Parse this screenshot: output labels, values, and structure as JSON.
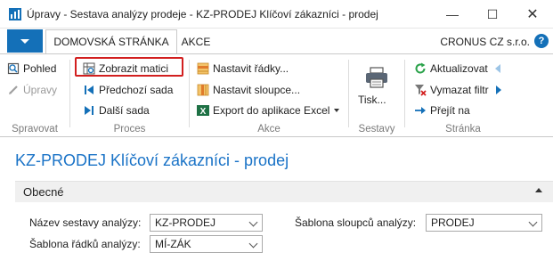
{
  "window": {
    "title": "Úpravy - Sestava analýzy prodeje - KZ-PRODEJ Klíčoví zákazníci - prodej",
    "minimize": "—",
    "maximize": "☐",
    "close": "✕"
  },
  "ribbon_tabs": {
    "home": "DOMOVSKÁ STRÁNKA",
    "actions": "AKCE",
    "company": "CRONUS CZ s.r.o.",
    "help": "?"
  },
  "ribbon": {
    "groups": {
      "spravovat": "Spravovat",
      "proces": "Proces",
      "akce": "Akce",
      "sestavy": "Sestavy",
      "stranka": "Stránka"
    },
    "buttons": {
      "pohled": "Pohled",
      "upravy": "Úpravy",
      "zobrazit_matici": "Zobrazit matici",
      "predchozi_sada": "Předchozí sada",
      "dalsi_sada": "Další sada",
      "nastavit_radky": "Nastavit řádky...",
      "nastavit_sloupce": "Nastavit sloupce...",
      "export_excel": "Export do aplikace Excel",
      "tisk": "Tisk...",
      "aktualizovat": "Aktualizovat",
      "vymazat_filtr": "Vymazat filtr",
      "prejit_na": "Přejít na"
    }
  },
  "page": {
    "title": "KZ-PRODEJ Klíčoví zákazníci - prodej",
    "fasttab": "Obecné",
    "fields": {
      "nazev_sestavy_label": "Název sestavy analýzy:",
      "nazev_sestavy_value": "KZ-PRODEJ",
      "sablona_radku_label": "Šablona řádků analýzy:",
      "sablona_radku_value": "MÍ-ZÁK",
      "sablona_sloupcu_label": "Šablona sloupců analýzy:",
      "sablona_sloupcu_value": "PRODEJ"
    }
  },
  "colors": {
    "accent": "#1470b8",
    "title_blue": "#1a73c7",
    "highlight_red": "#d21f1f",
    "excel_green": "#1e7145"
  }
}
